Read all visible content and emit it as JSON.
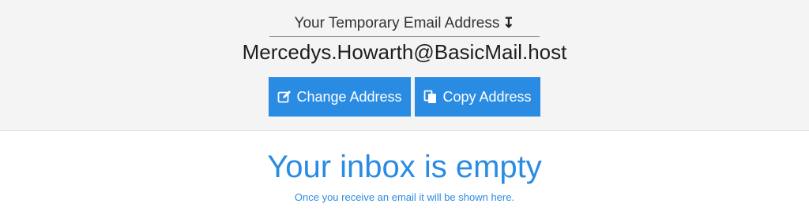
{
  "header": {
    "label": "Your Temporary Email Address",
    "label_icon": "down-arrow-icon",
    "email": "Mercedys.Howarth@BasicMail.host",
    "buttons": {
      "change_label": "Change Address",
      "change_icon": "edit-icon",
      "copy_label": "Copy Address",
      "copy_icon": "copy-icon"
    }
  },
  "inbox": {
    "title": "Your inbox is empty",
    "subtitle": "Once you receive an email it will be shown here."
  },
  "colors": {
    "accent": "#2a8be3",
    "header_bg": "#f4f4f4"
  }
}
